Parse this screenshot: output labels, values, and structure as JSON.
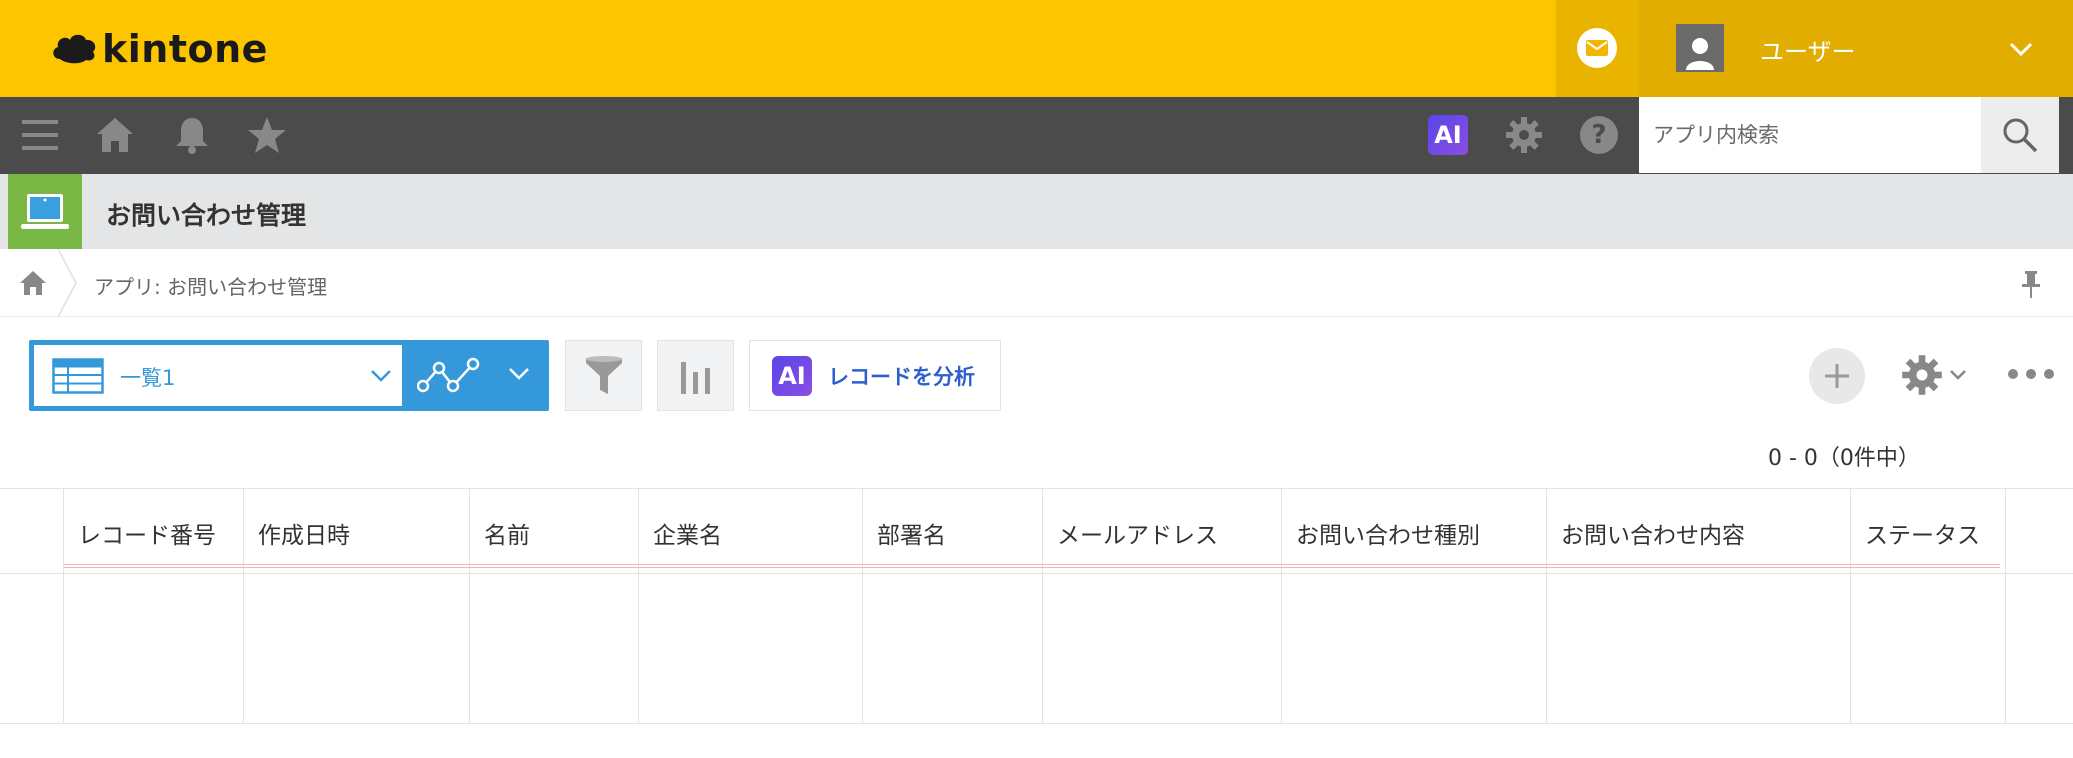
{
  "header": {
    "logo_text": "kintone",
    "user_name": "ユーザー",
    "brand_color": "#fdc400"
  },
  "toolbar": {
    "icons": [
      "menu-icon",
      "home-icon",
      "bell-icon",
      "star-icon",
      "ai-icon",
      "gear-icon",
      "help-icon"
    ],
    "ai_label": "AI",
    "help_label": "?",
    "search_placeholder": "アプリ内検索"
  },
  "app": {
    "title": "お問い合わせ管理",
    "breadcrumb": "アプリ: お問い合わせ管理"
  },
  "controls": {
    "view_name": "一覧1",
    "ai_badge": "AI",
    "ai_analyze_label": "レコードを分析",
    "pagination": "0 - 0（0件中）"
  },
  "table": {
    "columns": [
      "レコード番号",
      "作成日時",
      "名前",
      "企業名",
      "部署名",
      "メールアドレス",
      "お問い合わせ種別",
      "お問い合わせ内容",
      "ステータス"
    ],
    "rows": []
  }
}
